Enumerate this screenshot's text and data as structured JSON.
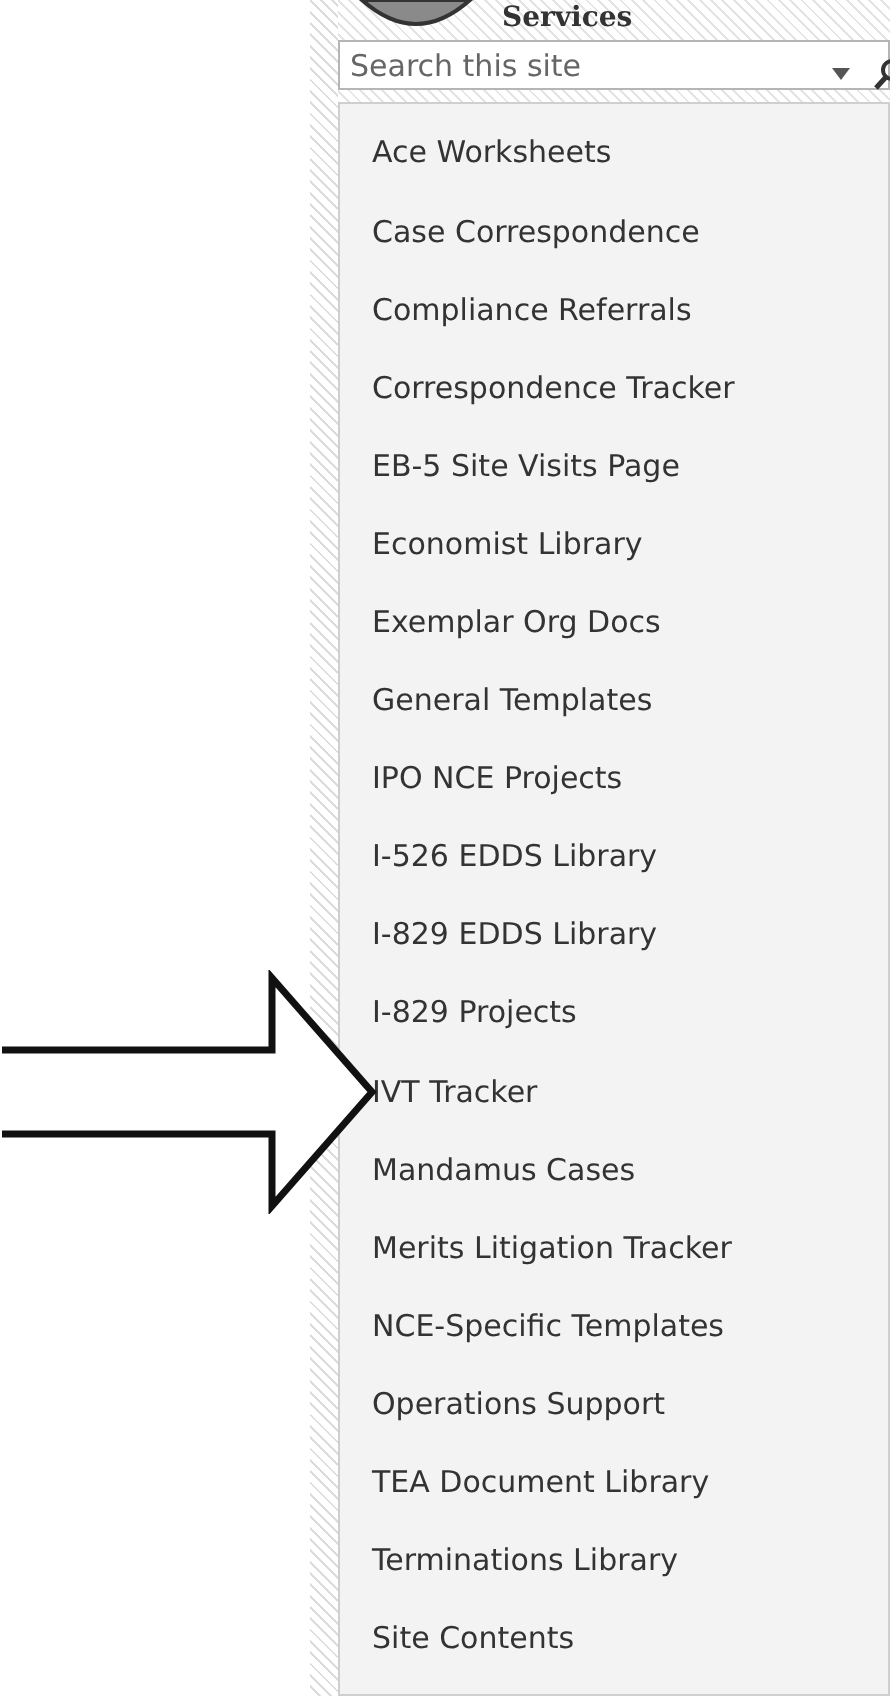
{
  "header": {
    "site_name": "Services"
  },
  "search": {
    "placeholder": "Search this site"
  },
  "nav": {
    "items": [
      {
        "label": "Ace Worksheets",
        "marked": false
      },
      {
        "label": "Case Correspondence",
        "marked": false
      },
      {
        "label": "Compliance Referrals",
        "marked": false
      },
      {
        "label": "Correspondence Tracker",
        "marked": false
      },
      {
        "label": "EB-5 Site Visits Page",
        "marked": false
      },
      {
        "label": "Economist Library",
        "marked": false
      },
      {
        "label": "Exemplar Org Docs",
        "marked": false
      },
      {
        "label": "General Templates",
        "marked": false
      },
      {
        "label": "IPO NCE Projects",
        "marked": false
      },
      {
        "label": "I-526 EDDS Library",
        "marked": false
      },
      {
        "label": "I-829 EDDS Library",
        "marked": false
      },
      {
        "label": "I-829 Projects",
        "marked": false
      },
      {
        "label": "IVT Tracker",
        "marked": true
      },
      {
        "label": "Mandamus Cases",
        "marked": false
      },
      {
        "label": "Merits Litigation Tracker",
        "marked": false
      },
      {
        "label": "NCE-Specific Templates",
        "marked": false
      },
      {
        "label": "Operations Support",
        "marked": false
      },
      {
        "label": "TEA Document Library",
        "marked": false
      },
      {
        "label": "Terminations Library",
        "marked": false
      },
      {
        "label": "Site Contents",
        "marked": false
      }
    ]
  }
}
